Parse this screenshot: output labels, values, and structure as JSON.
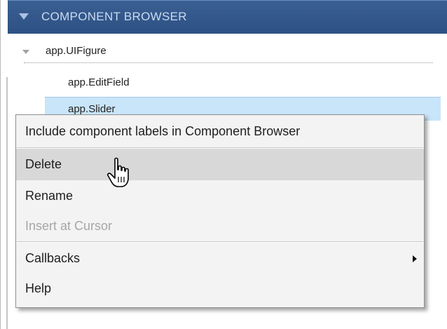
{
  "panel": {
    "title": "COMPONENT BROWSER"
  },
  "tree": {
    "root_label": "app.UIFigure",
    "children": [
      {
        "label": "app.EditField",
        "selected": false
      },
      {
        "label": "app.Slider",
        "selected": true
      }
    ]
  },
  "context_menu": {
    "items": [
      {
        "label": "Include component labels in Component Browser",
        "enabled": true
      },
      {
        "label": "Delete",
        "enabled": true,
        "hovered": true
      },
      {
        "label": "Rename",
        "enabled": true
      },
      {
        "label": "Insert at Cursor",
        "enabled": false
      },
      {
        "label": "Callbacks",
        "enabled": true,
        "has_submenu": true
      },
      {
        "label": "Help",
        "enabled": true
      }
    ]
  },
  "colors": {
    "header_bg": "#2e5184",
    "header_text": "#c9daf1",
    "selection_bg": "#c9e5f9",
    "menu_hover_bg": "#d8d8d8",
    "disabled_text": "#a6a6a6"
  },
  "cursor": {
    "icon": "hand-pointer-icon"
  }
}
